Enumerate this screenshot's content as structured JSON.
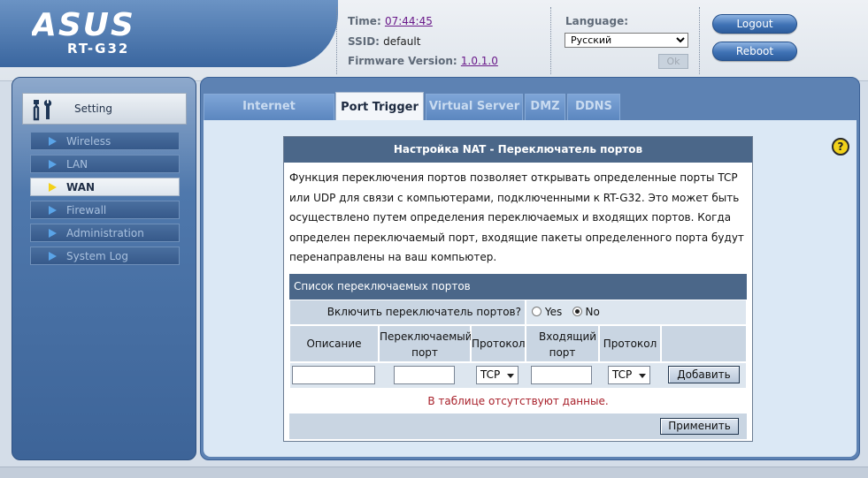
{
  "brand": {
    "logo_text": "ASUS",
    "model": "RT-G32"
  },
  "header": {
    "time_label": "Time:",
    "time_value": "07:44:45",
    "ssid_label": "SSID:",
    "ssid_value": "default",
    "firmware_label": "Firmware Version:",
    "firmware_value": "1.0.1.0",
    "language_label": "Language:",
    "language_value": "Русский",
    "ok_label": "Ok",
    "logout_label": "Logout",
    "reboot_label": "Reboot"
  },
  "sidebar": {
    "setting_label": "Setting",
    "items": [
      {
        "label": "Wireless",
        "active": false
      },
      {
        "label": "LAN",
        "active": false
      },
      {
        "label": "WAN",
        "active": true
      },
      {
        "label": "Firewall",
        "active": false
      },
      {
        "label": "Administration",
        "active": false
      },
      {
        "label": "System Log",
        "active": false
      }
    ]
  },
  "tabs": [
    {
      "label": "Internet Connection",
      "active": false
    },
    {
      "label": "Port Trigger",
      "active": true
    },
    {
      "label": "Virtual Server",
      "active": false
    },
    {
      "label": "DMZ",
      "active": false
    },
    {
      "label": "DDNS",
      "active": false
    }
  ],
  "nat": {
    "title": "Настройка NAT - Переключатель портов",
    "description": "Функция переключения портов позволяет открывать определенные порты TCP или UDP для связи с компьютерами, подключенными к RT-G32. Это может быть осуществлено путем определения переключаемых и входящих портов. Когда определен переключаемый порт, входящие пакеты определенного порта будут перенаправлены на ваш компьютер.",
    "list_header": "Список переключаемых портов",
    "enable_label": "Включить переключатель портов?",
    "radio_yes": "Yes",
    "radio_no": "No",
    "enabled": "No",
    "col_description": "Описание",
    "col_trigger_port": "Переключаемый порт",
    "col_protocol": "Протокол",
    "col_incoming_port": "Входящий порт",
    "col_protocol2": "Протокол",
    "protocol_value": "TCP",
    "protocol2_value": "TCP",
    "add_button": "Добавить",
    "no_data": "В таблице отсутствуют данные.",
    "apply_button": "Применить"
  }
}
